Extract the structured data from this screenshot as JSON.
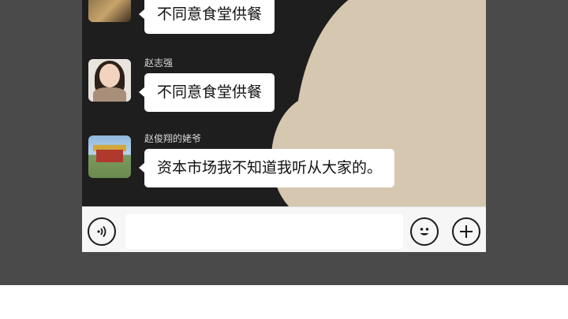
{
  "messages": [
    {
      "sender": "",
      "text": "不同意食堂供餐",
      "avatar": "food-photo-avatar"
    },
    {
      "sender": "赵志强",
      "text": "不同意食堂供餐",
      "avatar": "woman-portrait-avatar"
    },
    {
      "sender": "赵俊翔的姥爷",
      "text": "资本市场我不知道我听从大家的。",
      "avatar": "tiananmen-photo-avatar"
    }
  ],
  "input_bar": {
    "voice_icon": "voice-icon",
    "emoji_icon": "emoji-icon",
    "plus_icon": "plus-icon",
    "input_value": ""
  },
  "colors": {
    "page_background": "#4a4a4a",
    "chat_background": "#1e1e1e",
    "wallpaper": "#d6c7b0",
    "bubble": "#ffffff",
    "input_bar": "#f6f6f6"
  }
}
